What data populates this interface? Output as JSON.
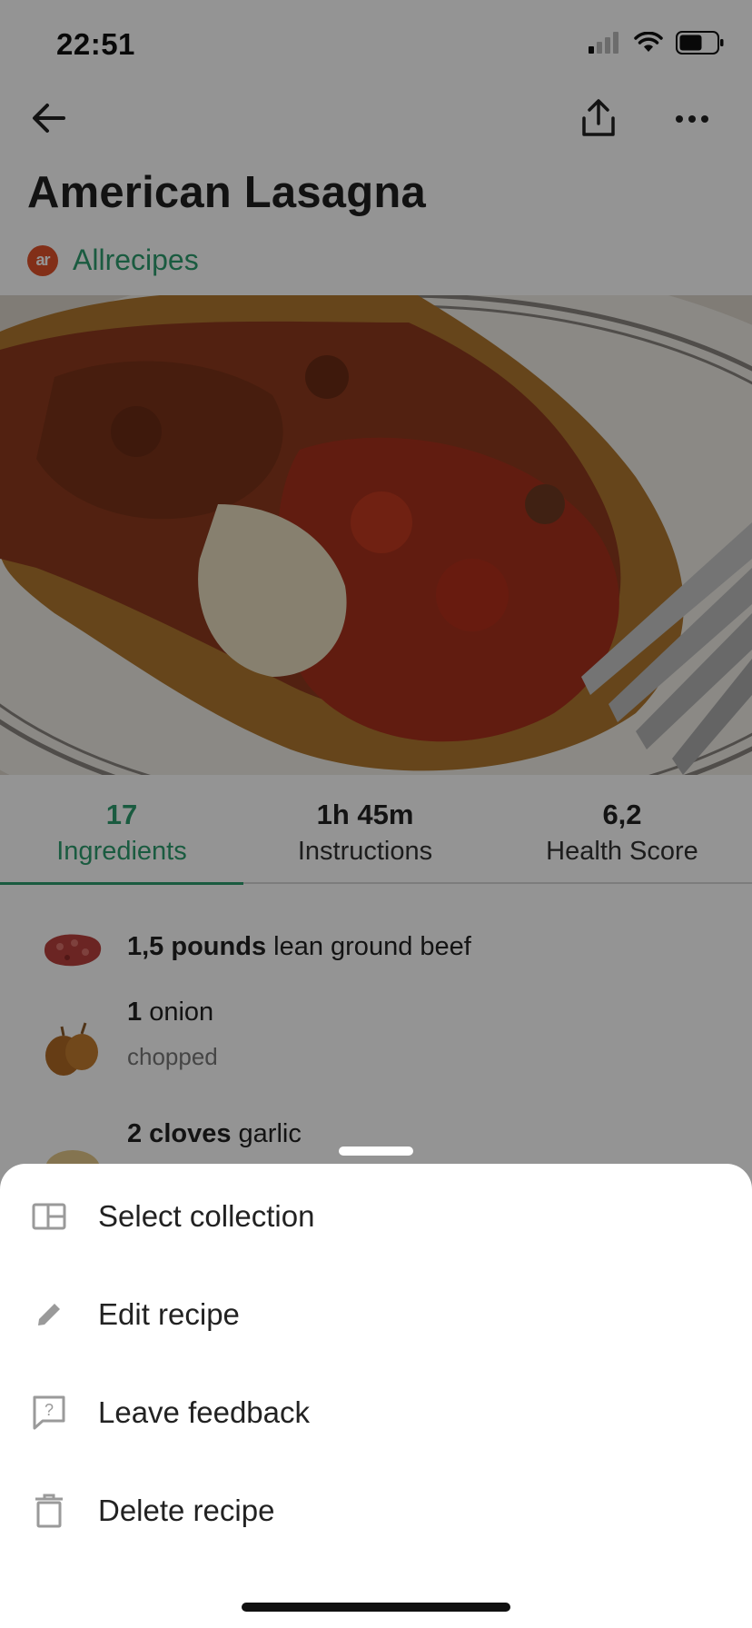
{
  "status_bar": {
    "time": "22:51",
    "icons": [
      "signal-icon",
      "wifi-icon",
      "battery-icon"
    ]
  },
  "nav": {
    "back_icon": "arrow-left-icon",
    "share_icon": "share-icon",
    "more_icon": "more-horizontal-icon"
  },
  "recipe": {
    "title": "American Lasagna",
    "source_logo_text": "ar",
    "source_name": "Allrecipes"
  },
  "tabs": [
    {
      "value": "17",
      "label": "Ingredients",
      "active": true
    },
    {
      "value": "1h 45m",
      "label": "Instructions",
      "active": false
    },
    {
      "value": "6,2",
      "label": "Health Score",
      "active": false
    }
  ],
  "ingredients": [
    {
      "quantity": "1,5 pounds",
      "name": "lean ground beef",
      "note": ""
    },
    {
      "quantity": "1",
      "name": "onion",
      "note": "chopped"
    },
    {
      "quantity": "2 cloves",
      "name": "garlic",
      "note": ""
    }
  ],
  "sheet": {
    "items": [
      {
        "label": "Select collection",
        "icon": "collection-icon"
      },
      {
        "label": "Edit recipe",
        "icon": "pencil-icon"
      },
      {
        "label": "Leave feedback",
        "icon": "feedback-icon"
      },
      {
        "label": "Delete recipe",
        "icon": "trash-icon"
      }
    ]
  },
  "colors": {
    "accent": "#2e9e6e",
    "source_logo": "#e0522a",
    "overlay": "rgba(0,0,0,0.42)"
  }
}
